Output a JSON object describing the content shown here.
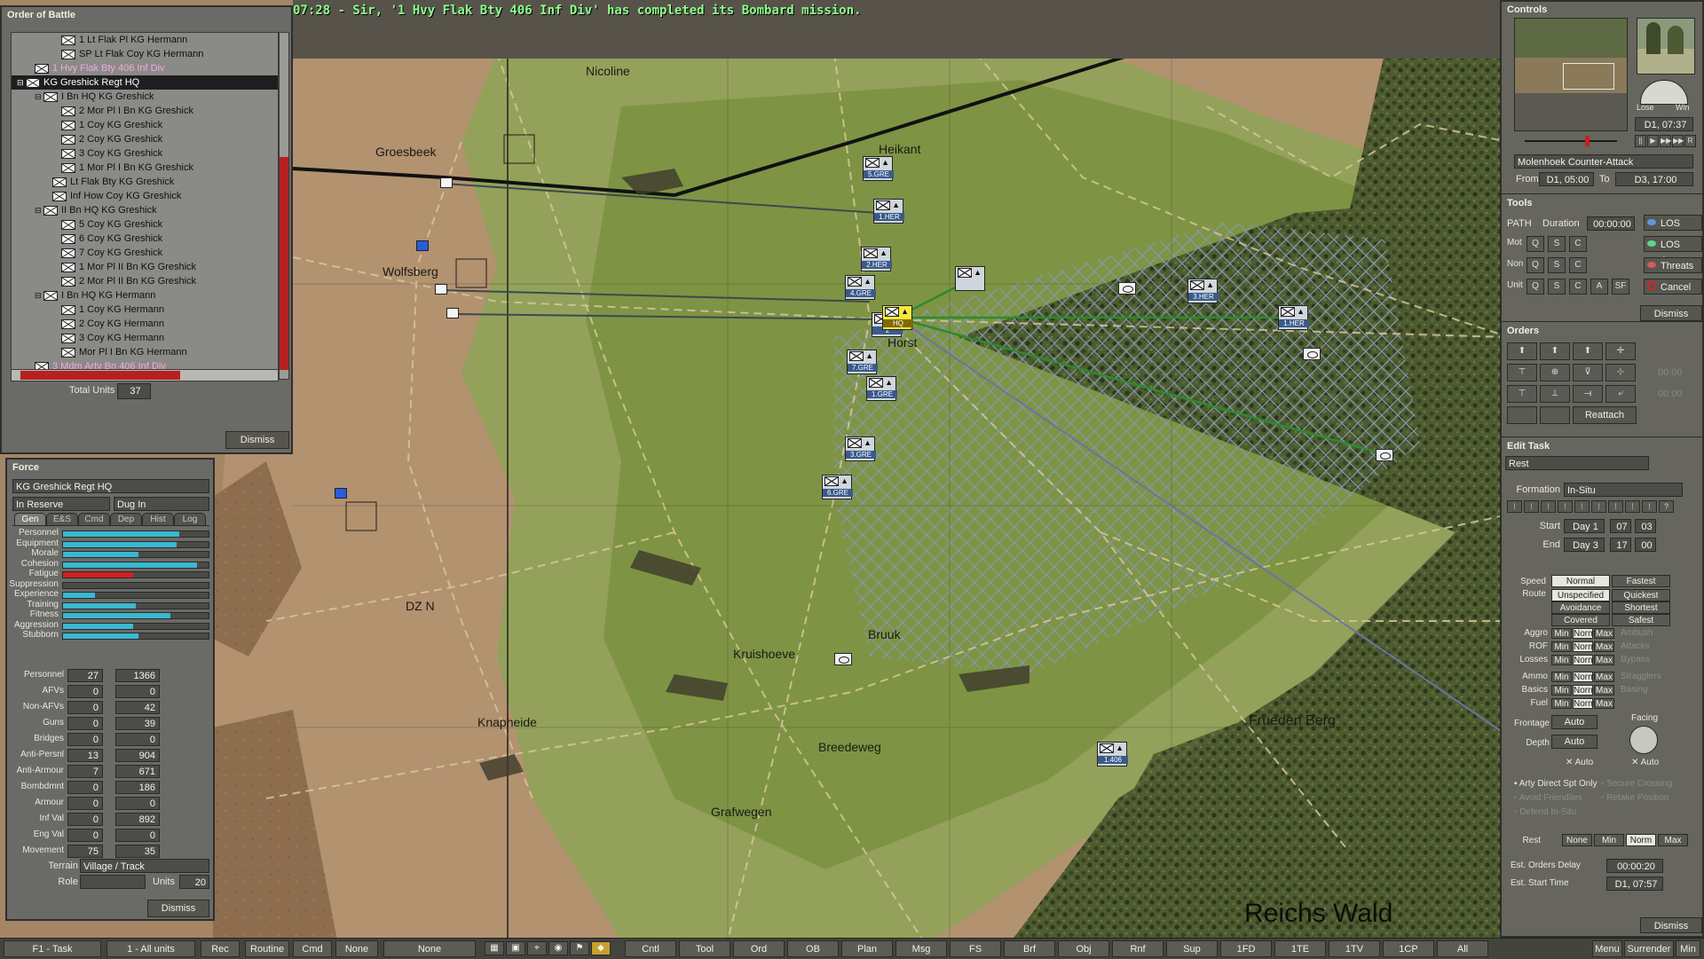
{
  "message": "07:28 - Sir, '1 Hvy Flak Bty 406 Inf Div' has completed its Bombard mission.",
  "map": {
    "places": [
      {
        "name": "Nicoline",
        "cls": ""
      },
      {
        "name": "Groesbeek",
        "cls": ""
      },
      {
        "name": "Heikant",
        "cls": ""
      },
      {
        "name": "Wolfsberg",
        "cls": ""
      },
      {
        "name": "Horst",
        "cls": ""
      },
      {
        "name": "DZ N",
        "cls": ""
      },
      {
        "name": "Bruuk",
        "cls": ""
      },
      {
        "name": "Kruishoeve",
        "cls": ""
      },
      {
        "name": "Knapheide",
        "cls": ""
      },
      {
        "name": "Breedeweg",
        "cls": ""
      },
      {
        "name": "Grafwegen",
        "cls": ""
      },
      {
        "name": "Frueden Berg",
        "cls": ""
      },
      {
        "name": "Reichs Wald",
        "cls": "big"
      }
    ],
    "units": [
      "5.GRE",
      "1.HER",
      "2.HER",
      "4.GRE",
      "2",
      "HQ",
      "7.GRE",
      "1.GRE",
      "3.GRE",
      "6.GRE",
      "3.HER",
      "1.HER",
      "1.406"
    ]
  },
  "oob": {
    "title": "Order of Battle",
    "items": [
      {
        "label": "1 Lt Flak Pl KG Hermann",
        "indent": 4,
        "cls": ""
      },
      {
        "label": "SP Lt Flak Coy KG Hermann",
        "indent": 4,
        "cls": ""
      },
      {
        "label": "1 Hvy Flak Bty 406 Inf Div",
        "indent": 1,
        "cls": "pink"
      },
      {
        "label": "KG Greshick Regt HQ",
        "indent": 0,
        "cls": "sel"
      },
      {
        "label": "I Bn HQ KG Greshick",
        "indent": 2,
        "cls": ""
      },
      {
        "label": "2 Mor Pl I Bn KG Greshick",
        "indent": 4,
        "cls": ""
      },
      {
        "label": "1 Coy KG Greshick",
        "indent": 4,
        "cls": ""
      },
      {
        "label": "2 Coy KG Greshick",
        "indent": 4,
        "cls": ""
      },
      {
        "label": "3 Coy KG Greshick",
        "indent": 4,
        "cls": ""
      },
      {
        "label": "1 Mor Pl I Bn KG Greshick",
        "indent": 4,
        "cls": ""
      },
      {
        "label": "Lt Flak Bty KG Greshick",
        "indent": 3,
        "cls": ""
      },
      {
        "label": "Inf How Coy KG Greshick",
        "indent": 3,
        "cls": ""
      },
      {
        "label": "II Bn HQ KG Greshick",
        "indent": 2,
        "cls": ""
      },
      {
        "label": "5 Coy KG Greshick",
        "indent": 4,
        "cls": ""
      },
      {
        "label": "6 Coy KG Greshick",
        "indent": 4,
        "cls": ""
      },
      {
        "label": "7 Coy KG Greshick",
        "indent": 4,
        "cls": ""
      },
      {
        "label": "1 Mor Pl II Bn KG Greshick",
        "indent": 4,
        "cls": ""
      },
      {
        "label": "2 Mor Pl II Bn KG Greshick",
        "indent": 4,
        "cls": ""
      },
      {
        "label": "I Bn HQ KG Hermann",
        "indent": 2,
        "cls": ""
      },
      {
        "label": "1 Coy KG Hermann",
        "indent": 4,
        "cls": ""
      },
      {
        "label": "2 Coy KG Hermann",
        "indent": 4,
        "cls": ""
      },
      {
        "label": "3 Coy KG Hermann",
        "indent": 4,
        "cls": ""
      },
      {
        "label": "Mor Pl I Bn KG Hermann",
        "indent": 4,
        "cls": ""
      },
      {
        "label": "3 Mdm Arty Bn 406 Inf Div",
        "indent": 1,
        "cls": "pink"
      }
    ],
    "total_label": "Total Units",
    "total_value": "37",
    "dismiss": "Dismiss"
  },
  "force": {
    "title": "Force",
    "name": "KG Greshick Regt HQ",
    "status": "In Reserve",
    "posture": "Dug In",
    "tabs": [
      "Gen",
      "E&S",
      "Cmd",
      "Dep",
      "Hist",
      "Log"
    ],
    "bars": [
      {
        "label": "Personnel",
        "level": 0.8,
        "color": "#3ab8d0"
      },
      {
        "label": "Equipment",
        "level": 0.78,
        "color": "#3ab8d0"
      },
      {
        "label": "Morale",
        "level": 0.52,
        "color": "#3ab8d0"
      },
      {
        "label": "Cohesion",
        "level": 0.92,
        "color": "#3ab8d0"
      },
      {
        "label": "Fatigue",
        "level": 0.48,
        "color": "#d02020"
      },
      {
        "label": "Suppression",
        "level": 0.0,
        "color": "#3ab8d0"
      },
      {
        "label": "Experience",
        "level": 0.22,
        "color": "#3ab8d0"
      },
      {
        "label": "Training",
        "level": 0.5,
        "color": "#3ab8d0"
      },
      {
        "label": "Fitness",
        "level": 0.74,
        "color": "#3ab8d0"
      },
      {
        "label": "Aggression",
        "level": 0.48,
        "color": "#3ab8d0"
      },
      {
        "label": "Stubborn",
        "level": 0.52,
        "color": "#3ab8d0"
      }
    ],
    "stats": [
      {
        "label": "Personnel",
        "a": "27",
        "b": "1366"
      },
      {
        "label": "AFVs",
        "a": "0",
        "b": "0"
      },
      {
        "label": "Non-AFVs",
        "a": "0",
        "b": "42"
      },
      {
        "label": "Guns",
        "a": "0",
        "b": "39"
      },
      {
        "label": "Bridges",
        "a": "0",
        "b": "0"
      },
      {
        "label": "Anti-Persnl",
        "a": "13",
        "b": "904"
      },
      {
        "label": "Anti-Armour",
        "a": "7",
        "b": "671"
      },
      {
        "label": "Bombdmnt",
        "a": "0",
        "b": "186"
      },
      {
        "label": "Armour",
        "a": "0",
        "b": "0"
      },
      {
        "label": "Inf Val",
        "a": "0",
        "b": "892"
      },
      {
        "label": "Eng Val",
        "a": "0",
        "b": "0"
      },
      {
        "label": "Movement",
        "a": "75",
        "b": "35"
      }
    ],
    "terrain_label": "Terrain",
    "terrain_value": "Village / Track",
    "role_label": "Role",
    "units_label": "Units",
    "units_value": "20",
    "dismiss": "Dismiss"
  },
  "controls": {
    "title": "Controls",
    "lose": "Lose",
    "win": "Win",
    "time": "D1, 07:37",
    "scenario": "Molenhoek Counter-Attack",
    "from_label": "From",
    "from_value": "D1, 05:00",
    "to_label": "To",
    "to_value": "D3, 17:00",
    "playback": [
      "||",
      "▶",
      "▶▶",
      "▶▶|",
      "R"
    ]
  },
  "tools": {
    "title": "Tools",
    "path_label": "PATH",
    "duration_label": "Duration",
    "duration_value": "00:00:00",
    "rows": [
      {
        "label": "Mot",
        "keys": [
          "Q",
          "S",
          "C"
        ]
      },
      {
        "label": "Non",
        "keys": [
          "Q",
          "S",
          "C"
        ]
      },
      {
        "label": "Unit",
        "keys": [
          "Q",
          "S",
          "C",
          "A",
          "SF"
        ]
      }
    ],
    "los": "LOS",
    "los_area": "LOS Area",
    "threats": "Threats",
    "cancel": "Cancel",
    "dismiss": "Dismiss"
  },
  "orders": {
    "title": "Orders",
    "reattach": "Reattach",
    "times": [
      "00:00",
      "00:00"
    ]
  },
  "edit": {
    "title": "Edit Task",
    "task": "Rest",
    "formation_label": "Formation",
    "formation_value": "In-Situ",
    "start_label": "Start",
    "start_day": "Day 1",
    "start_h": "07",
    "start_m": "03",
    "end_label": "End",
    "end_day": "Day 3",
    "end_h": "17",
    "end_m": "00",
    "speed_label": "Speed",
    "speed": [
      "Normal",
      "Fastest"
    ],
    "route_label": "Route",
    "route": [
      "Unspecified",
      "Quickest",
      "Avoidance",
      "Shortest",
      "Covered",
      "Safest"
    ],
    "mnm_rows": [
      {
        "label": "Aggro",
        "side": "Ambush"
      },
      {
        "label": "ROF",
        "side": "Attacks"
      },
      {
        "label": "Losses",
        "side": "Bypass"
      },
      {
        "label": "Ammo",
        "side": "Stragglers"
      },
      {
        "label": "Basics",
        "side": "Basing"
      },
      {
        "label": "Fuel",
        "side": ""
      }
    ],
    "mnm": [
      "Min",
      "Norm",
      "Max"
    ],
    "frontage_label": "Frontage",
    "frontage": "Auto",
    "depth_label": "Depth",
    "depth": "Auto",
    "facing_label": "Facing",
    "auto1": "Auto",
    "auto2": "Auto",
    "checks": [
      "Arty Direct Spt Only",
      "Secure Crossing",
      "Avoid Friendlies",
      "Retake Position",
      "Defend In-Situ"
    ],
    "rest_label": "Rest",
    "rest": [
      "None",
      "Min",
      "Norm",
      "Max"
    ],
    "delay_label": "Est. Orders Delay",
    "delay": "00:00:20",
    "start_time_label": "Est. Start Time",
    "start_time": "D1, 07:57",
    "dismiss": "Dismiss"
  },
  "bottom": {
    "left": [
      "F1 - Task",
      "1 - All units",
      "Rec",
      "Routine",
      "Cmd",
      "None",
      "None"
    ],
    "right": [
      "Cntl",
      "Tool",
      "Ord",
      "OB",
      "Plan",
      "Msg",
      "FS",
      "Brf",
      "Obj",
      "Rnf",
      "Sup",
      "1FD",
      "1TE",
      "1TV",
      "1CP",
      "All"
    ],
    "far": [
      "Menu",
      "Surrender",
      "Min"
    ]
  }
}
